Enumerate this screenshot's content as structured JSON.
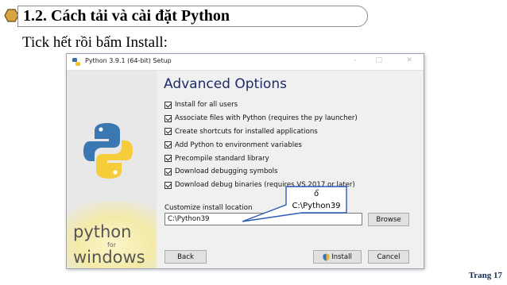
{
  "slide": {
    "section_title": "1.2.    Cách tải và cài đặt Python",
    "instruction": "Tick hết rồi bấm Install:",
    "page_number": "Trang 17"
  },
  "window": {
    "title": "Python 3.9.1 (64-bit) Setup",
    "controls": {
      "minimize": "–",
      "maximize": "□",
      "close": "✕"
    }
  },
  "sidebar": {
    "brand_line1": "python",
    "brand_line2": "for",
    "brand_line3": "windows"
  },
  "main": {
    "heading": "Advanced Options",
    "options": [
      {
        "label": "Install for all users",
        "checked": true
      },
      {
        "label": "Associate files with Python (requires the py launcher)",
        "checked": true
      },
      {
        "label": "Create shortcuts for installed applications",
        "checked": true
      },
      {
        "label": "Add Python to environment variables",
        "checked": true
      },
      {
        "label": "Precompile standard library",
        "checked": true
      },
      {
        "label": "Download debugging symbols",
        "checked": true
      },
      {
        "label": "Download debug binaries (requires VS 2017 or later)",
        "checked": true
      }
    ],
    "location_label": "Customize install location",
    "location_value": "C:\\Python39",
    "browse_label": "Browse",
    "back_label": "Back",
    "install_label": "Install",
    "cancel_label": "Cancel"
  },
  "callout": {
    "line1": "ổ",
    "line2": "C:\\Python39"
  },
  "colors": {
    "heading": "#1f2b6b",
    "callout_border": "#2b5cb8",
    "header_hex": "#b07d2a"
  }
}
